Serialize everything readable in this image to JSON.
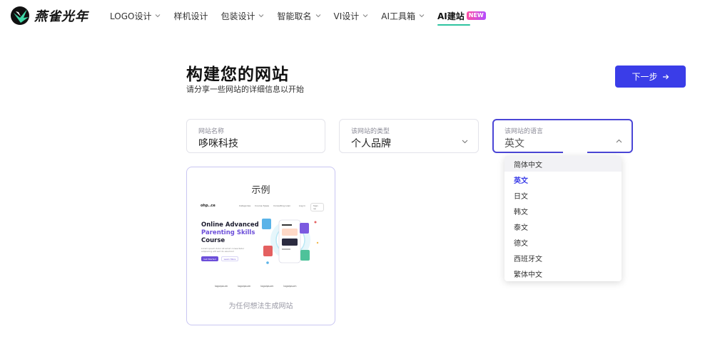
{
  "nav": {
    "logo_text": "燕雀光年",
    "items": [
      {
        "label": "LOGO设计",
        "has_dropdown": true
      },
      {
        "label": "样机设计",
        "has_dropdown": false
      },
      {
        "label": "包装设计",
        "has_dropdown": true
      },
      {
        "label": "智能取名",
        "has_dropdown": true
      },
      {
        "label": "VI设计",
        "has_dropdown": true
      },
      {
        "label": "AI工具箱",
        "has_dropdown": true
      },
      {
        "label": "AI建站",
        "has_dropdown": false,
        "active": true,
        "badge": "NEW"
      }
    ]
  },
  "header": {
    "title": "构建您的网站",
    "subtitle": "请分享一些网站的详细信息以开始",
    "next_button": "下一步"
  },
  "fields": {
    "site_name": {
      "label": "网站名称",
      "value": "哆咪科技"
    },
    "site_type": {
      "label": "该网站的类型",
      "value": "个人品牌"
    },
    "site_language": {
      "label": "该网站的语言",
      "value": "英文"
    }
  },
  "language_options": [
    "简体中文",
    "英文",
    "日文",
    "韩文",
    "泰文",
    "德文",
    "西班牙文",
    "繁体中文"
  ],
  "language_selected": "英文",
  "language_hovered": "简体中文",
  "example_card": {
    "title": "示例",
    "caption": "为任何想法生成网站",
    "preview": {
      "brand": "ohp..ce",
      "nav": [
        "Categories",
        "Course Types",
        "Consulting Loan"
      ],
      "login": "Log in",
      "signup": "Sign up",
      "headline_1": "Online Advanced",
      "headline_highlight": "Parenting Skills",
      "headline_2": "Course",
      "body": "Lorem ipsum dolor sit amet consectetur adipiscing elit sed do eiusmod",
      "primary_button": "Get Started",
      "secondary_button": "Learn More",
      "partner_logos": [
        "logoipsum",
        "logoipsum",
        "logoipsum",
        "logoipsum"
      ]
    }
  },
  "colors": {
    "accent": "#3a3de8",
    "active_underline": "#2ec4a0",
    "focus_border": "#4b46d6"
  }
}
